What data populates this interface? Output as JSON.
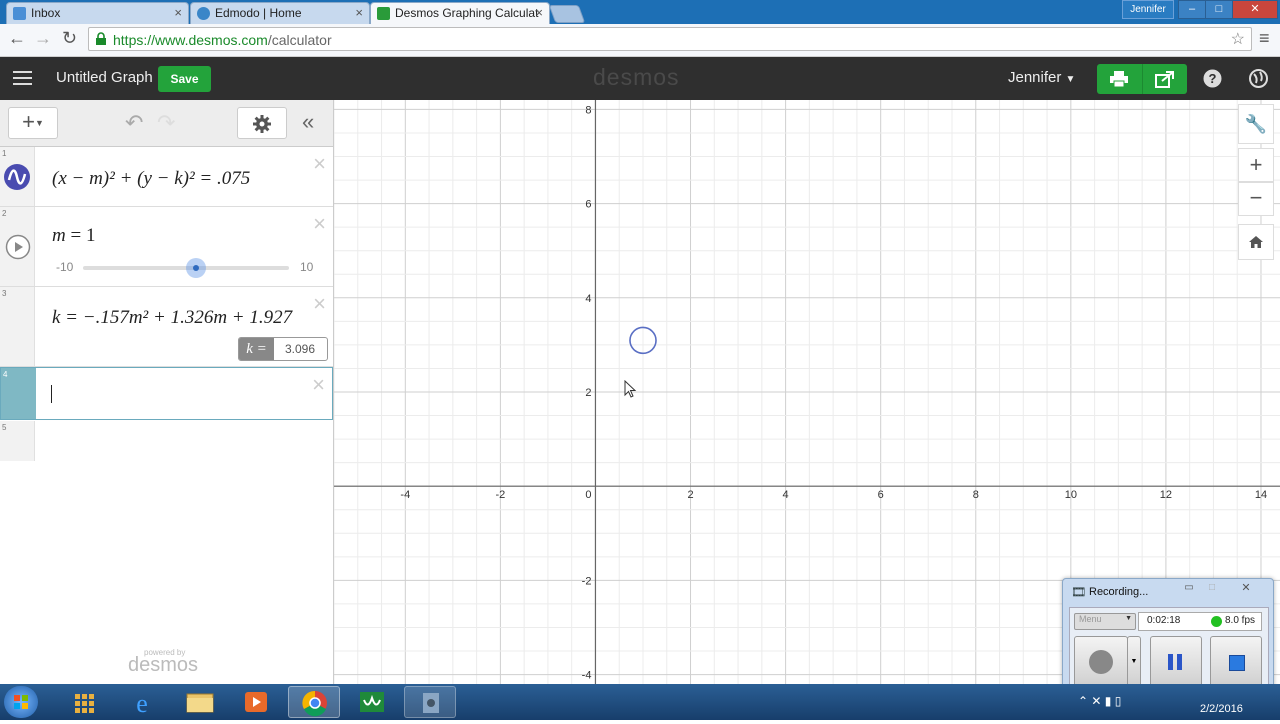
{
  "browser": {
    "tabs": [
      {
        "label": "Inbox",
        "icon": "gmail-icon"
      },
      {
        "label": "Edmodo | Home",
        "icon": "edmodo-icon"
      },
      {
        "label": "Desmos Graphing Calculat",
        "icon": "desmos-tab-icon"
      }
    ],
    "close_glyph": "×",
    "user_chip": "Jennifer",
    "window_buttons": {
      "minimize": "–",
      "maximize": "□",
      "close": "✕"
    },
    "url_host": "https://www.desmos.com",
    "url_path": "/calculator"
  },
  "desmos": {
    "menu_icon": "hamburger-icon",
    "title": "Untitled Graph",
    "save_label": "Save",
    "wordmark": "desmos",
    "user": "Jennifer",
    "expressions": [
      {
        "index": "1",
        "type": "equation",
        "latex_text": "(x − m)² + (y − k)² = .075"
      },
      {
        "index": "2",
        "type": "slider",
        "var": "m",
        "value": "1",
        "min_label": "-10",
        "max_label": "10",
        "slider_fraction": 0.55
      },
      {
        "index": "3",
        "type": "equation",
        "latex_text": "k = −.157m² + 1.326m + 1.927",
        "eval_label": "k =",
        "eval_value": "3.096"
      },
      {
        "index": "4",
        "type": "empty"
      },
      {
        "index": "5",
        "type": "empty"
      }
    ],
    "powered_by": "powered by",
    "powered_brand": "desmos"
  },
  "graph": {
    "x_ticks": [
      "-4",
      "-2",
      "0",
      "2",
      "4",
      "6",
      "8",
      "10",
      "12",
      "14"
    ],
    "y_ticks_pos": [
      "8",
      "6",
      "4",
      "2"
    ],
    "y_ticks_neg": [
      "-2",
      "-4"
    ],
    "x_range": [
      -5.5,
      14.4
    ],
    "y_range": [
      -4.2,
      8.2
    ],
    "circle": {
      "cx": 1,
      "cy": 3.096,
      "r": 0.274
    }
  },
  "recorder": {
    "title": "Recording...",
    "menu_label": "Menu",
    "elapsed": "0:02:18",
    "fps": "8.0 fps",
    "status_color": "#22c022"
  },
  "taskbar": {
    "clock_date": "2/2/2016"
  }
}
